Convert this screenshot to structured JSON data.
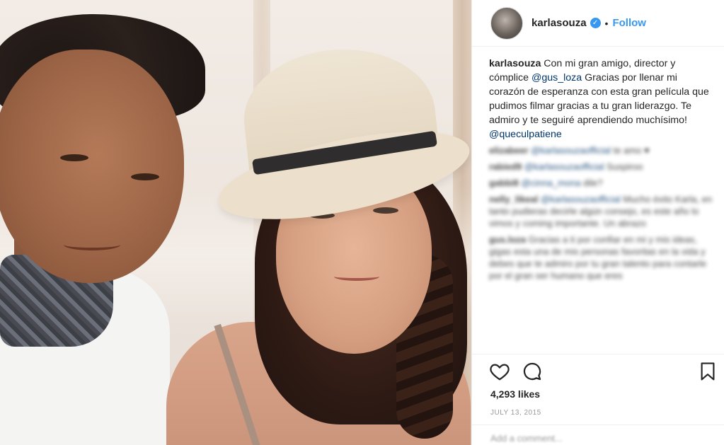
{
  "header": {
    "username": "karlasouza",
    "verified_symbol": "✓",
    "separator": "•",
    "follow_label": "Follow"
  },
  "caption": {
    "username": "karlasouza",
    "text_1": " Con mi gran amigo, director y cómplice ",
    "mention_1": "@gus_loza",
    "text_2": " Gracias por llenar mi corazón de esperanza con esta gran película que pudimos filmar gracias a tu gran liderazgo. Te admiro y te seguiré aprendiendo muchísimo! ",
    "mention_2": "@queculpatiene"
  },
  "comments": [
    {
      "user": "elizabeer",
      "mention": "@karlasouzaofficial",
      "text": "te amo ♥"
    },
    {
      "user": "rabied9",
      "mention": "@karlasouzaofficial",
      "text": " Suspiroo"
    },
    {
      "user": "gabbi8",
      "mention": "@cinna_mona",
      "text": " dile?"
    },
    {
      "user": "nelly_likeal",
      "mention": "@karlasouzaofficial",
      "text": " Mucho éxito Karla, en tanto pudieras decirle algún consejo, es este año lo vimos y coming importante. Un abrazo"
    },
    {
      "user": "gus.loza",
      "mention": "",
      "text": " Gracias a ti por confiar en mi y mis ideas, gigas esta una de mis personas favoritas en la vida y debes que te admiro por tu gran talento para contarle por el gran ser humano que eres"
    }
  ],
  "actions": {
    "like_icon": "heart-outline",
    "comment_icon": "speech-bubble-outline",
    "save_icon": "bookmark-outline"
  },
  "likes": "4,293 likes",
  "date": "JULY 13, 2015",
  "add_comment_placeholder": "Add a comment..."
}
